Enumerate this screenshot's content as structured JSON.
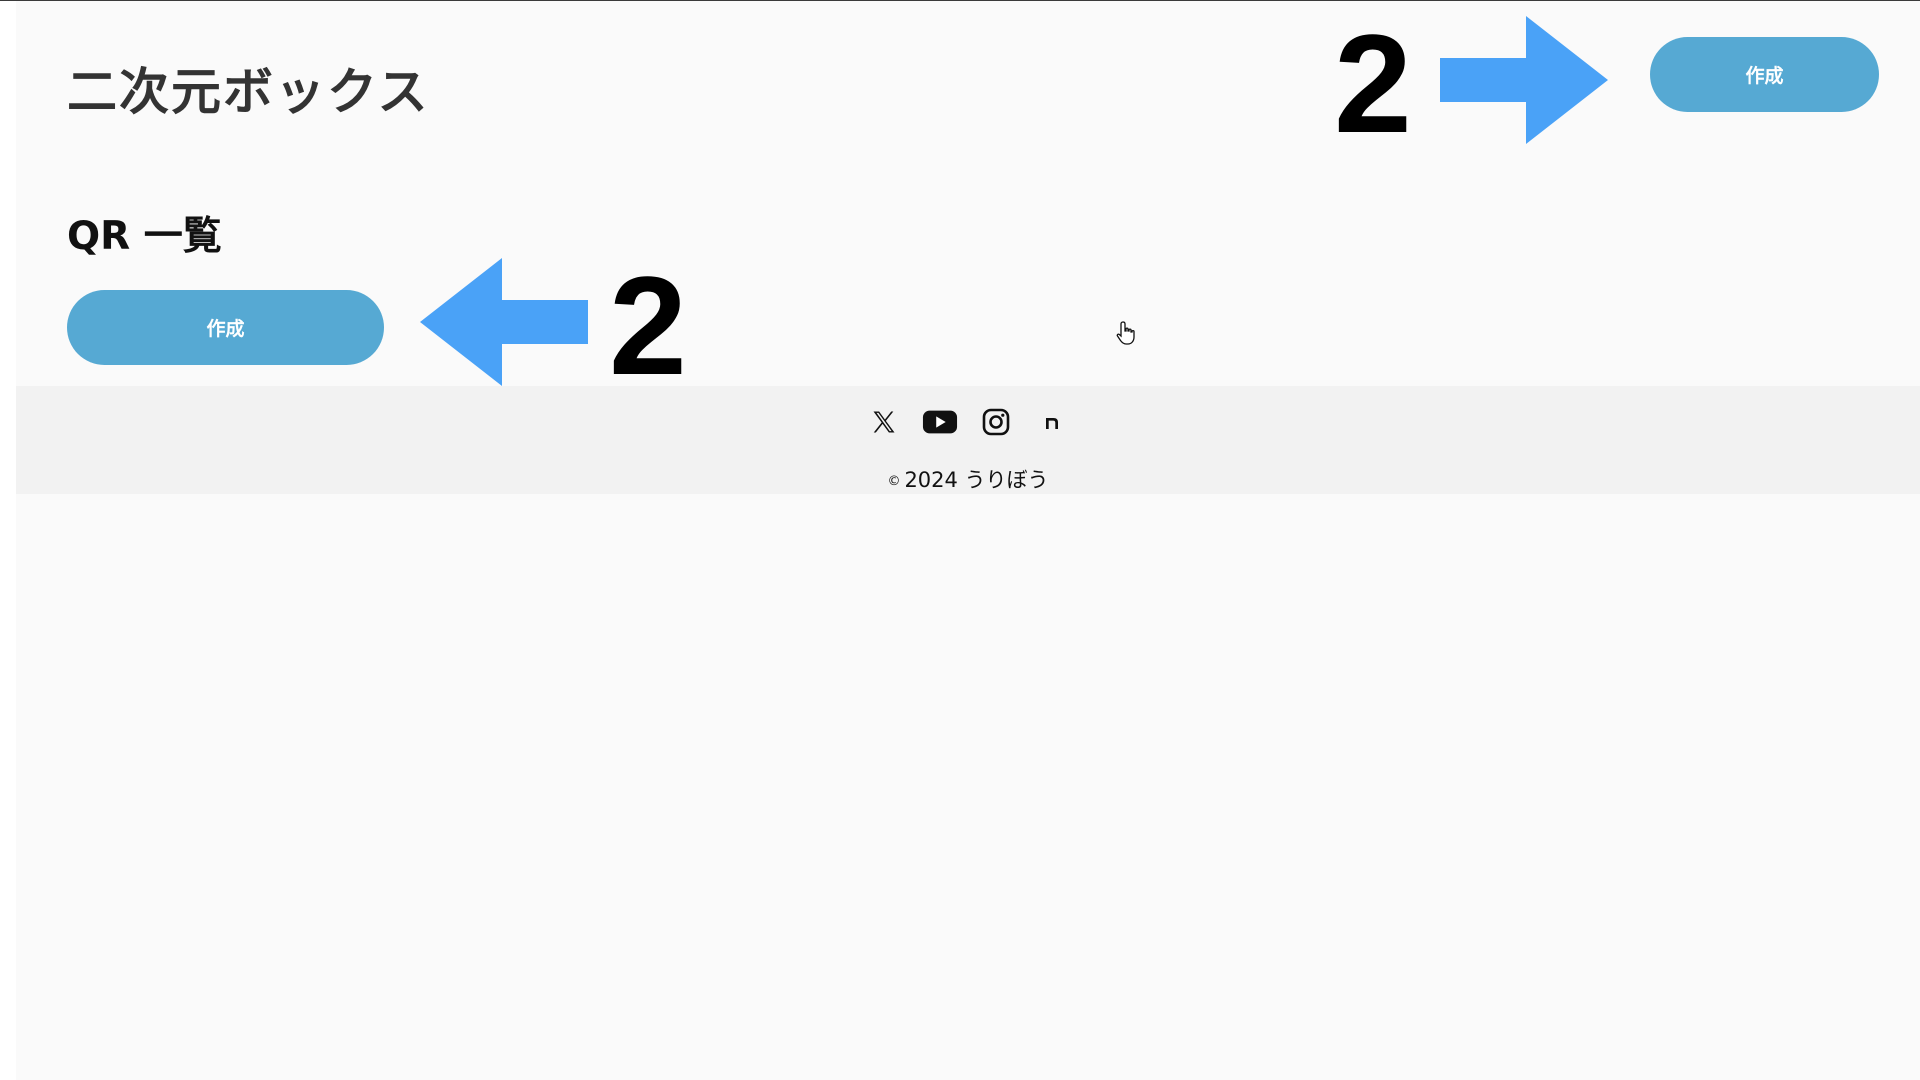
{
  "site": {
    "title": "二次元ボックス"
  },
  "header": {
    "create_button_label": "作成"
  },
  "main": {
    "section_title": "QR 一覧",
    "create_button_label": "作成"
  },
  "annotations": {
    "step_number_header": "2",
    "step_number_main": "2",
    "arrow_color": "#4aa2f7"
  },
  "footer": {
    "social_links": [
      {
        "icon": "x-icon"
      },
      {
        "icon": "youtube-icon"
      },
      {
        "icon": "instagram-icon"
      },
      {
        "icon": "note-icon"
      }
    ],
    "copyright_symbol": "©",
    "copyright_text": "2024 うりぼう"
  },
  "colors": {
    "button": "#56a9d3",
    "page_background": "#fafafa",
    "footer_background": "#f2f2f2"
  }
}
